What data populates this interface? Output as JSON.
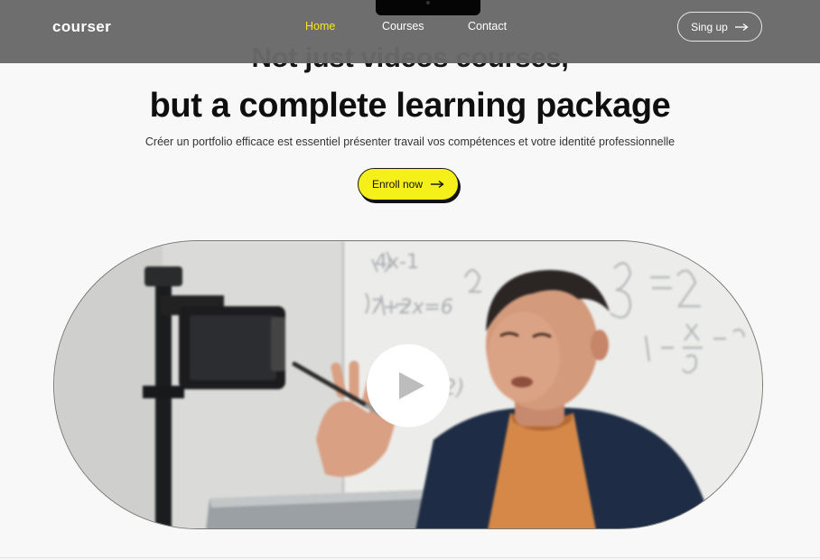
{
  "nav": {
    "logo": "courser",
    "links": [
      {
        "label": "Home",
        "active": true
      },
      {
        "label": "Courses",
        "active": false
      },
      {
        "label": "Contact",
        "active": false
      }
    ],
    "signup_label": "Sing up",
    "signup_icon": "arrow-right-icon"
  },
  "hero": {
    "headline_top": "Not just videos courses,",
    "headline_main": "but a complete learning package",
    "subtitle": "Créer un portfolio efficace est essentiel  présenter  travail vos compétences et votre identité professionnelle",
    "enroll_label": "Enroll now",
    "enroll_icon": "arrow-right-icon"
  },
  "video": {
    "play_icon": "play-icon",
    "board_text": {
      "l1": "4x-1",
      "l2": "7+2x=6",
      "l3": "2)",
      "l4": "2) 3=",
      "l5": "14 - x/3"
    }
  },
  "colors": {
    "accent": "#f3ea1c",
    "navbar": "#696969",
    "background": "#f8f8f8",
    "button_yellow": "#f5ef1a"
  }
}
